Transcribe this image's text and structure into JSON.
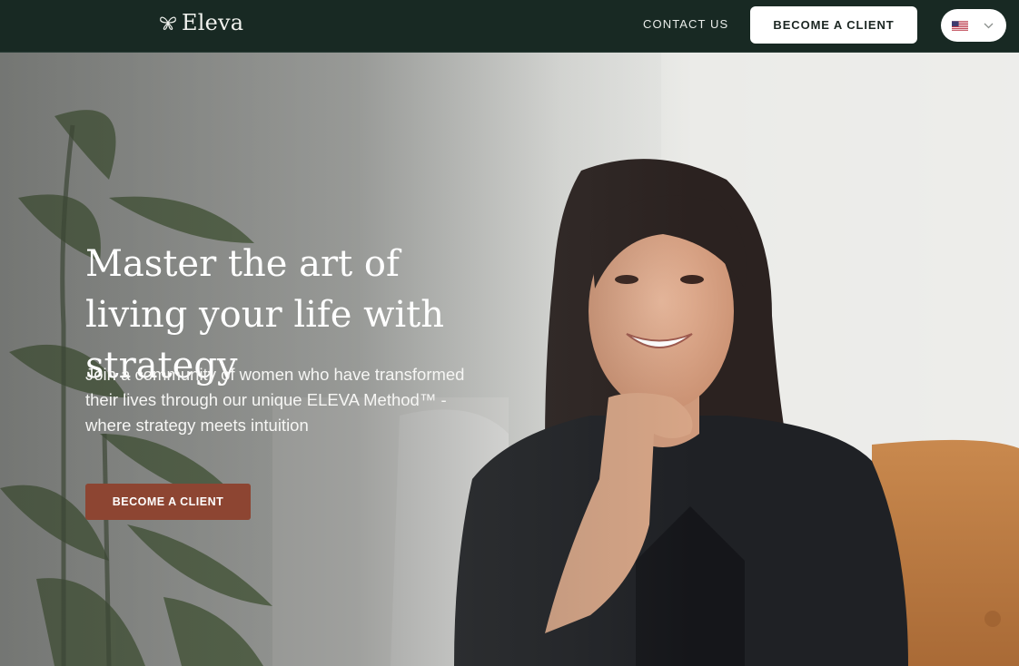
{
  "header": {
    "logo_text": "Eleva",
    "logo_icon": "butterfly-icon",
    "nav": {
      "contact_label": "CONTACT US"
    },
    "cta_label": "BECOME A CLIENT",
    "language": {
      "icon": "us-flag-icon",
      "dropdown_icon": "chevron-down-icon"
    }
  },
  "hero": {
    "title": "Master the art of living your life with strategy",
    "subtitle": "Join a community of women who have transformed their lives through our unique ELEVA Method™ - where strategy meets intuition",
    "cta_label": "BECOME A CLIENT",
    "image": "smiling-woman-portrait"
  },
  "colors": {
    "header_bg": "#182923",
    "hero_cta_bg": "#8d4532",
    "header_cta_bg": "#ffffff"
  }
}
